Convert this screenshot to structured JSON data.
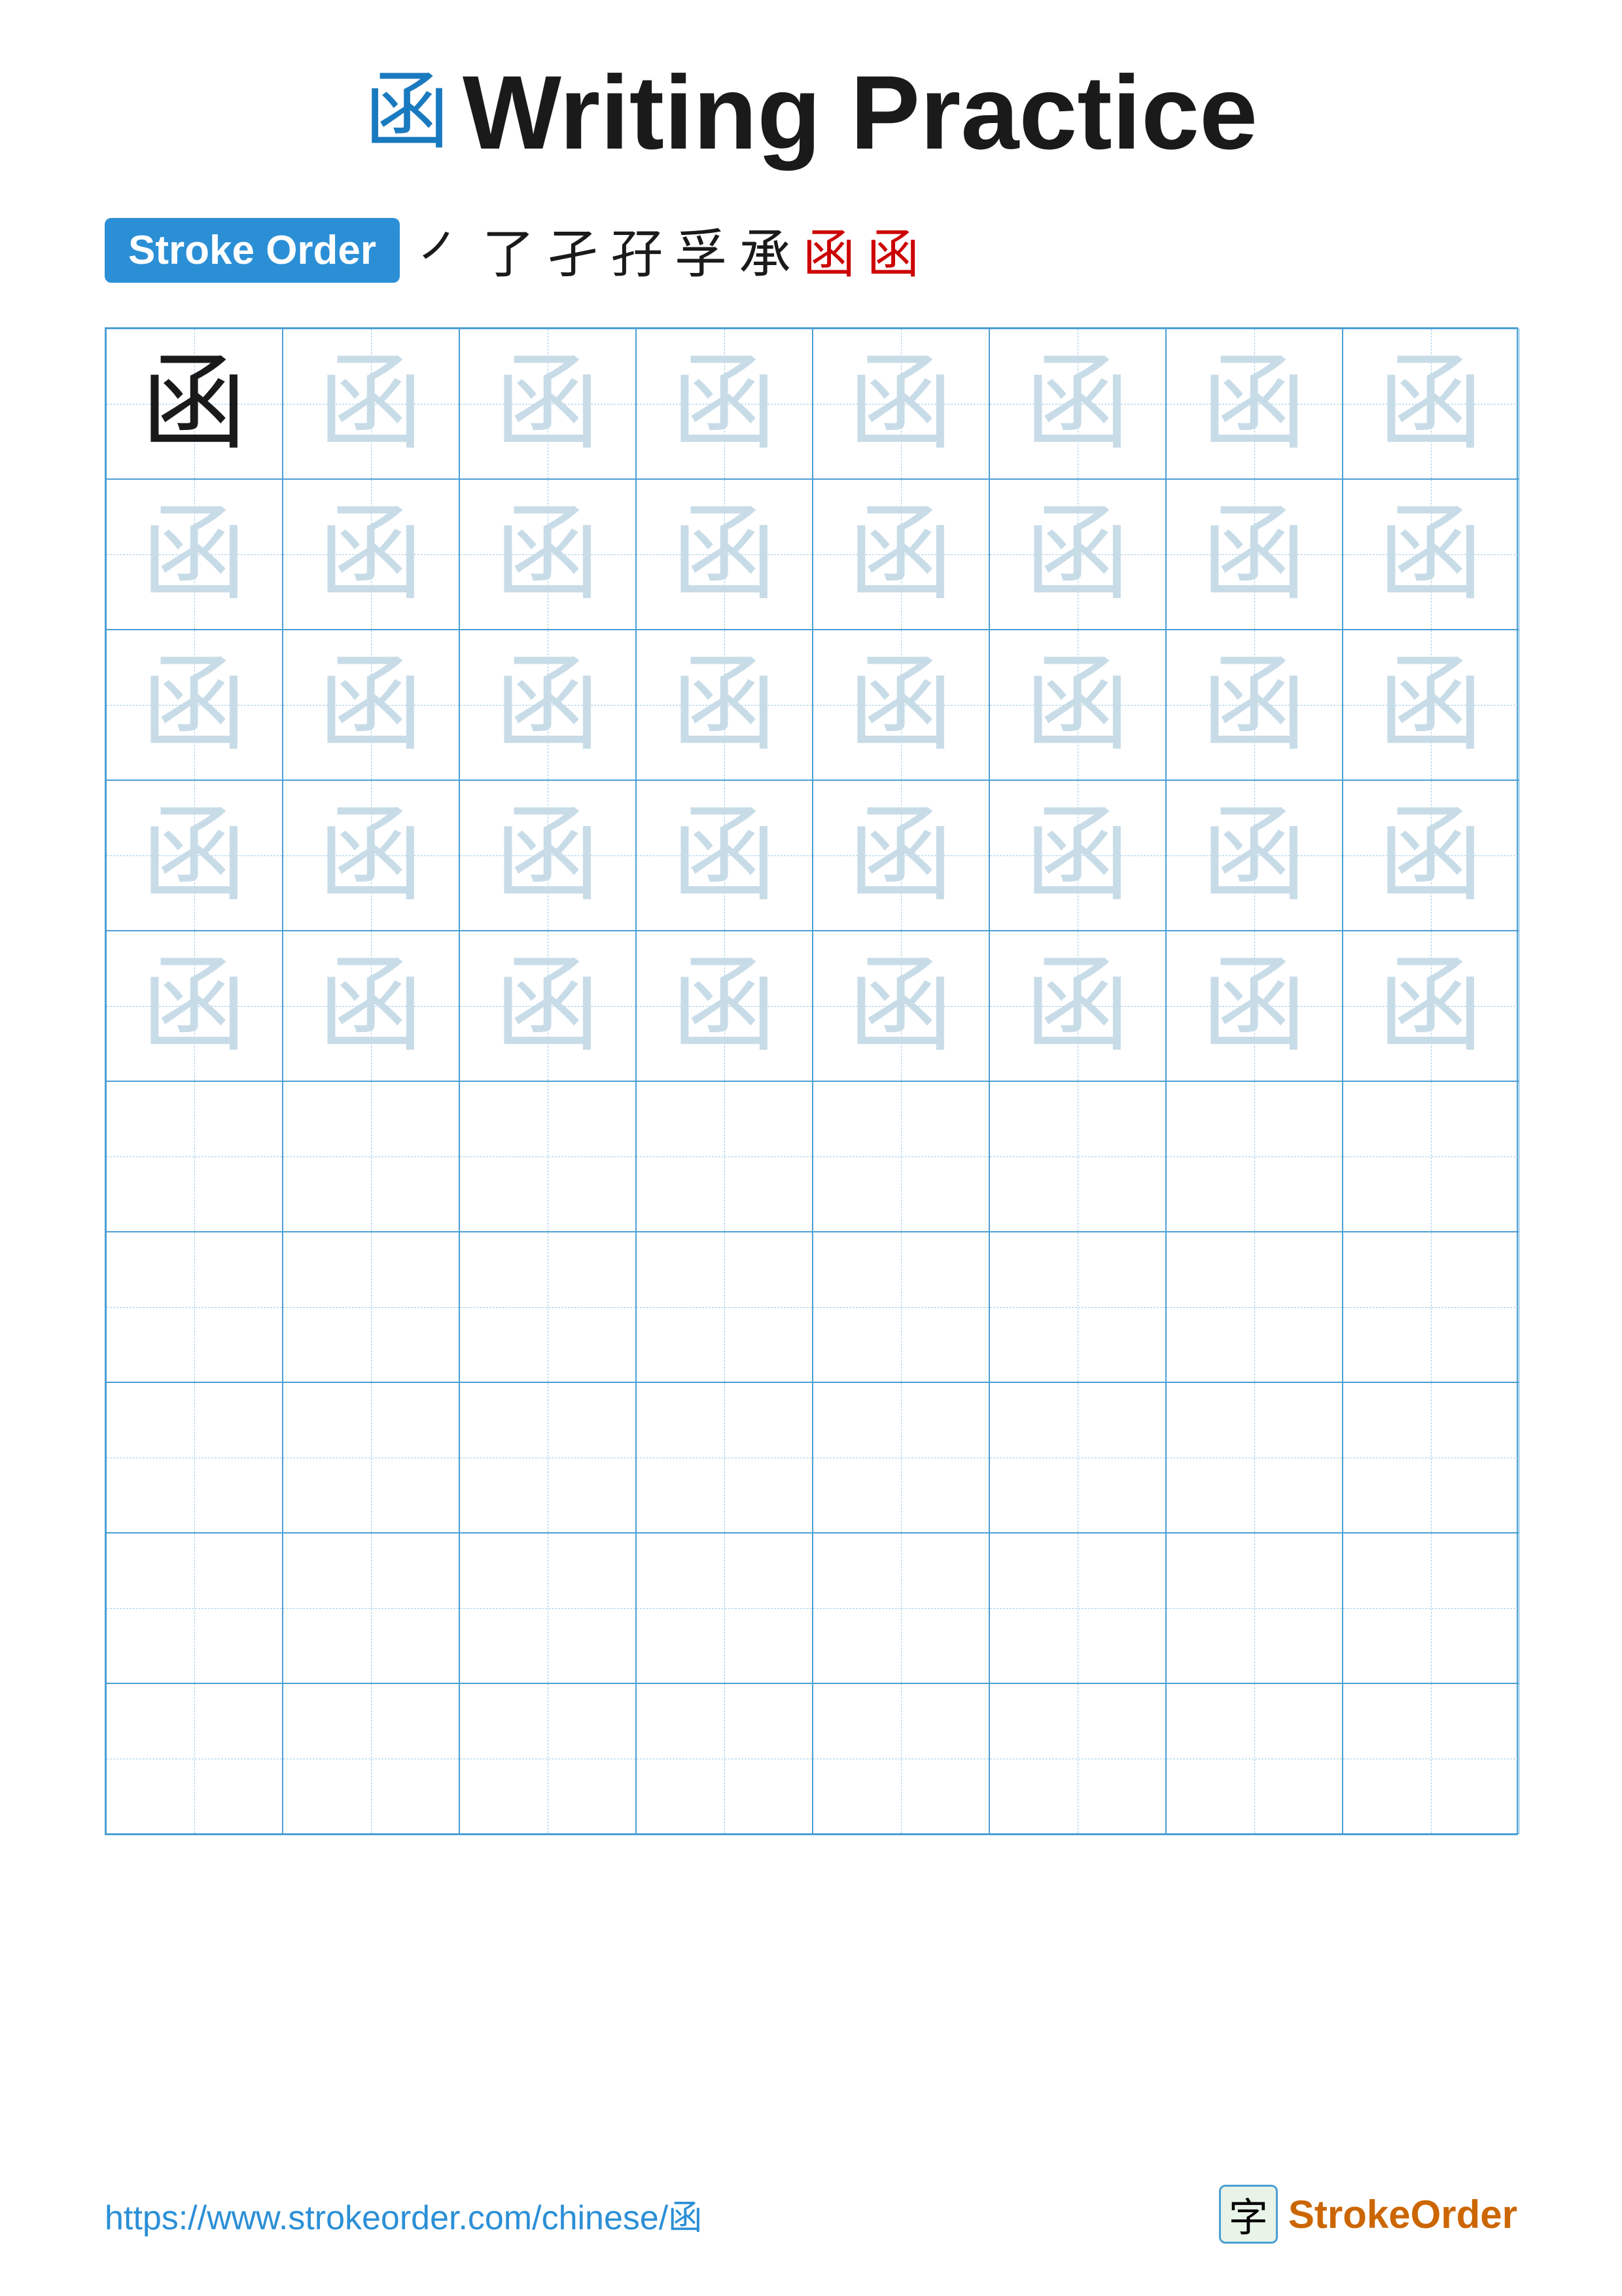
{
  "title": {
    "icon": "函",
    "text": "Writing Practice"
  },
  "stroke_order": {
    "badge_label": "Stroke Order",
    "steps": [
      "㇒",
      "了",
      "孑",
      "孖",
      "孚",
      "承",
      "函",
      "函"
    ]
  },
  "grid": {
    "rows": 10,
    "cols": 8,
    "character": "函",
    "filled_rows": 5,
    "empty_rows": 5
  },
  "footer": {
    "url": "https://www.strokeorder.com/chinese/函",
    "brand_icon": "字",
    "brand_name": "StrokeOrder"
  }
}
